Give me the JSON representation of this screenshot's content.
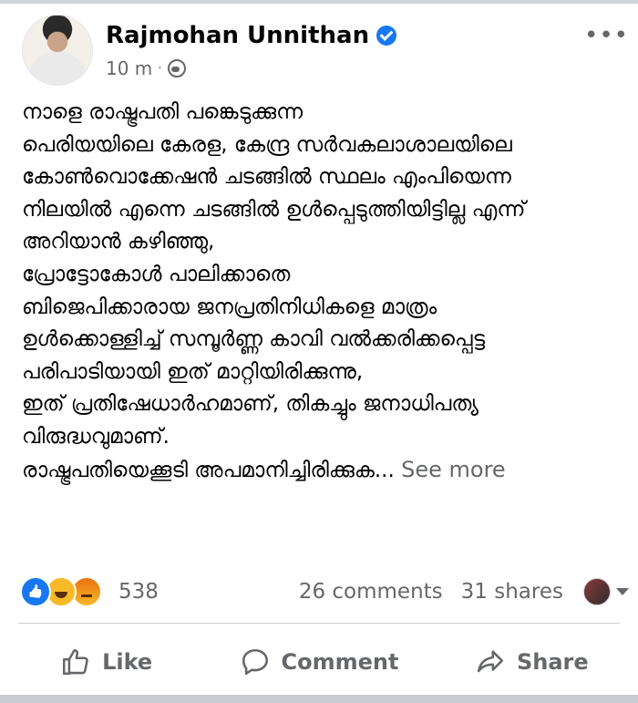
{
  "post": {
    "author": "Rajmohan Unnithan",
    "time": "10 m",
    "separator": "·",
    "lines": [
      "നാളെ രാഷ്ട്രപതി പങ്കെടുക്കുന്ന",
      "പെരിയയിലെ കേരള, കേന്ദ്ര സർവകലാശാലയിലെ",
      "കോൺവൊക്കേഷൻ ചടങ്ങിൽ സ്ഥലം എംപിയെന്ന",
      "നിലയിൽ എന്നെ ചടങ്ങിൽ ഉൾപ്പെടുത്തിയിട്ടില്ല എന്ന്",
      "അറിയാൻ കഴിഞ്ഞു,",
      "പ്രോട്ടോകോൾ പാലിക്കാതെ",
      "ബിജെപിക്കാരായ ജനപ്രതിനിധികളെ മാത്രം",
      "ഉൾക്കൊള്ളിച്ച് സമ്പൂർണ്ണ കാവി വൽക്കരിക്കപ്പെട്ട",
      "പരിപാടിയായി ഇത് മാറ്റിയിരിക്കുന്നു,",
      " ഇത് പ്രതിഷേധാർഹമാണ്, തികച്ചും ജനാധിപത്യ",
      "വിരുദ്ധവുമാണ്.",
      " രാഷ്ട്രപതിയെക്കൂടി അപമാനിച്ചിരിക്കുക..."
    ],
    "see_more": "See more"
  },
  "stats": {
    "reaction_count": "538",
    "comments": "26 comments",
    "shares": "31 shares"
  },
  "actions": {
    "like": "Like",
    "comment": "Comment",
    "share": "Share"
  },
  "icons": {
    "verified": "verified-badge-icon",
    "audience": "globe-icon",
    "menu": "more-dots-icon",
    "like": "thumbs-up-icon",
    "comment": "speech-bubble-icon",
    "share": "share-arrow-icon"
  },
  "colors": {
    "brand_blue": "#1877f2",
    "secondary_text": "#65676b",
    "primary_text": "#050505"
  }
}
